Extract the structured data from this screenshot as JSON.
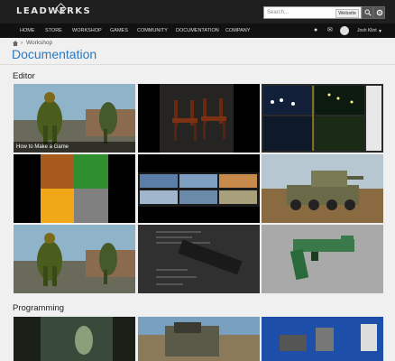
{
  "header": {
    "logo": "LEADWERKS",
    "search_placeholder": "Search...",
    "search_scope": "Website"
  },
  "nav": {
    "items": [
      "HOME",
      "STORE",
      "WORKSHOP",
      "GAMES",
      "COMMUNITY",
      "DOCUMENTATION",
      "COMPANY"
    ],
    "user": "Josh Klint"
  },
  "breadcrumb": {
    "item": "Workshop"
  },
  "page_title": "Documentation",
  "sections": {
    "editor": "Editor",
    "programming": "Programming"
  },
  "tiles": {
    "caption": "How to Make a Game"
  }
}
